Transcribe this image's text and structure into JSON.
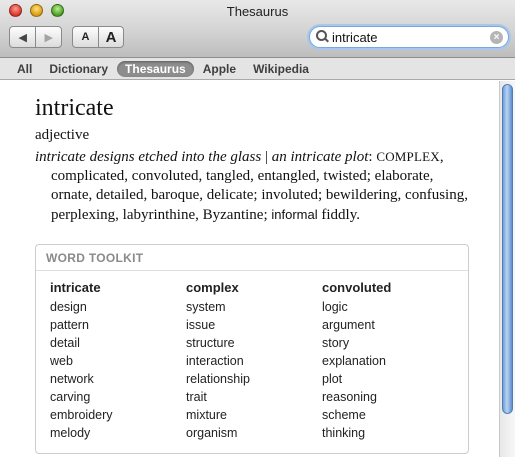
{
  "window": {
    "title": "Thesaurus"
  },
  "toolbar": {
    "back_glyph": "◀",
    "forward_glyph": "▶",
    "font_small_label": "A",
    "font_large_label": "A",
    "search_value": "intricate",
    "clear_glyph": "×"
  },
  "scope_tabs": [
    {
      "label": "All",
      "active": false
    },
    {
      "label": "Dictionary",
      "active": false
    },
    {
      "label": "Thesaurus",
      "active": true
    },
    {
      "label": "Apple",
      "active": false
    },
    {
      "label": "Wikipedia",
      "active": false
    }
  ],
  "entry": {
    "headword": "intricate",
    "part_of_speech": "adjective",
    "example_1": "intricate designs etched into the glass",
    "separator": " | ",
    "example_2": "an intricate plot",
    "colon": ": ",
    "core_synonym": "COMPLEX",
    "synonyms": ", complicated, convoluted, tangled, entangled, twisted; elaborate, ornate, detailed, baroque, delicate; involuted; bewildering, confusing, perplexing, labyrinthine, Byzantine; ",
    "register_label": "informal",
    "informal_synonym": " fiddly."
  },
  "word_toolkit": {
    "heading": "WORD TOOLKIT",
    "columns": [
      {
        "head": "intricate",
        "words": [
          "design",
          "pattern",
          "detail",
          "web",
          "network",
          "carving",
          "embroidery",
          "melody"
        ]
      },
      {
        "head": "complex",
        "words": [
          "system",
          "issue",
          "structure",
          "interaction",
          "relationship",
          "trait",
          "mixture",
          "organism"
        ]
      },
      {
        "head": "convoluted",
        "words": [
          "logic",
          "argument",
          "story",
          "explanation",
          "plot",
          "reasoning",
          "scheme",
          "thinking"
        ]
      }
    ]
  },
  "icons": {
    "search": "search-icon",
    "clear": "clear-search-icon"
  },
  "colors": {
    "scope_active": "#8d8d8d",
    "scroll_thumb": "#6f9fd8",
    "search_focus": "#a9c7ec"
  }
}
